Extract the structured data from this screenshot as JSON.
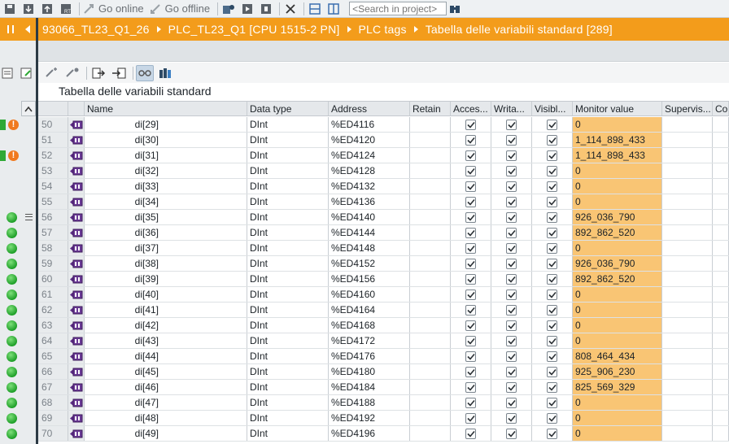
{
  "toolbar": {
    "go_online_label": "Go online",
    "go_offline_label": "Go offline",
    "search_placeholder": "<Search in project>"
  },
  "breadcrumb": [
    "93066_TL23_Q1_26",
    "PLC_TL23_Q1 [CPU 1515-2 PN]",
    "PLC tags",
    "Tabella delle variabili standard [289]"
  ],
  "table_title": "Tabella delle variabili standard",
  "columns": {
    "name": "Name",
    "data_type": "Data type",
    "address": "Address",
    "retain": "Retain",
    "accessible": "Acces...",
    "writable": "Writa...",
    "visible": "Visibl...",
    "monitor_value": "Monitor value",
    "supervision": "Supervis...",
    "comment": "Cor"
  },
  "rows": [
    {
      "num": "50",
      "name": "di[29]",
      "type": "DInt",
      "address": "%ED4116",
      "monitor": "0"
    },
    {
      "num": "51",
      "name": "di[30]",
      "type": "DInt",
      "address": "%ED4120",
      "monitor": "1_114_898_433"
    },
    {
      "num": "52",
      "name": "di[31]",
      "type": "DInt",
      "address": "%ED4124",
      "monitor": "1_114_898_433"
    },
    {
      "num": "53",
      "name": "di[32]",
      "type": "DInt",
      "address": "%ED4128",
      "monitor": "0"
    },
    {
      "num": "54",
      "name": "di[33]",
      "type": "DInt",
      "address": "%ED4132",
      "monitor": "0"
    },
    {
      "num": "55",
      "name": "di[34]",
      "type": "DInt",
      "address": "%ED4136",
      "monitor": "0"
    },
    {
      "num": "56",
      "name": "di[35]",
      "type": "DInt",
      "address": "%ED4140",
      "monitor": "926_036_790"
    },
    {
      "num": "57",
      "name": "di[36]",
      "type": "DInt",
      "address": "%ED4144",
      "monitor": "892_862_520"
    },
    {
      "num": "58",
      "name": "di[37]",
      "type": "DInt",
      "address": "%ED4148",
      "monitor": "0"
    },
    {
      "num": "59",
      "name": "di[38]",
      "type": "DInt",
      "address": "%ED4152",
      "monitor": "926_036_790"
    },
    {
      "num": "60",
      "name": "di[39]",
      "type": "DInt",
      "address": "%ED4156",
      "monitor": "892_862_520"
    },
    {
      "num": "61",
      "name": "di[40]",
      "type": "DInt",
      "address": "%ED4160",
      "monitor": "0"
    },
    {
      "num": "62",
      "name": "di[41]",
      "type": "DInt",
      "address": "%ED4164",
      "monitor": "0"
    },
    {
      "num": "63",
      "name": "di[42]",
      "type": "DInt",
      "address": "%ED4168",
      "monitor": "0"
    },
    {
      "num": "64",
      "name": "di[43]",
      "type": "DInt",
      "address": "%ED4172",
      "monitor": "0"
    },
    {
      "num": "65",
      "name": "di[44]",
      "type": "DInt",
      "address": "%ED4176",
      "monitor": "808_464_434"
    },
    {
      "num": "66",
      "name": "di[45]",
      "type": "DInt",
      "address": "%ED4180",
      "monitor": "925_906_230"
    },
    {
      "num": "67",
      "name": "di[46]",
      "type": "DInt",
      "address": "%ED4184",
      "monitor": "825_569_329"
    },
    {
      "num": "68",
      "name": "di[47]",
      "type": "DInt",
      "address": "%ED4188",
      "monitor": "0"
    },
    {
      "num": "69",
      "name": "di[48]",
      "type": "DInt",
      "address": "%ED4192",
      "monitor": "0"
    },
    {
      "num": "70",
      "name": "di[49]",
      "type": "DInt",
      "address": "%ED4196",
      "monitor": "0"
    }
  ],
  "status_markers": [
    {
      "row": 0,
      "kind": "warning"
    },
    {
      "row": 2,
      "kind": "warning"
    },
    {
      "row": 6,
      "kind": "ok"
    },
    {
      "row": 7,
      "kind": "ok"
    },
    {
      "row": 8,
      "kind": "ok"
    },
    {
      "row": 9,
      "kind": "ok"
    },
    {
      "row": 10,
      "kind": "ok"
    },
    {
      "row": 11,
      "kind": "ok"
    },
    {
      "row": 12,
      "kind": "ok"
    },
    {
      "row": 13,
      "kind": "ok"
    },
    {
      "row": 14,
      "kind": "ok"
    },
    {
      "row": 15,
      "kind": "ok"
    },
    {
      "row": 16,
      "kind": "ok"
    },
    {
      "row": 17,
      "kind": "ok"
    },
    {
      "row": 18,
      "kind": "ok"
    },
    {
      "row": 19,
      "kind": "ok"
    },
    {
      "row": 20,
      "kind": "ok"
    }
  ],
  "colors": {
    "breadcrumb_bg": "#f39c1b",
    "monitor_bg": "#f9c574",
    "status_ok": "#1e9f28",
    "status_warning": "#f07a20"
  }
}
